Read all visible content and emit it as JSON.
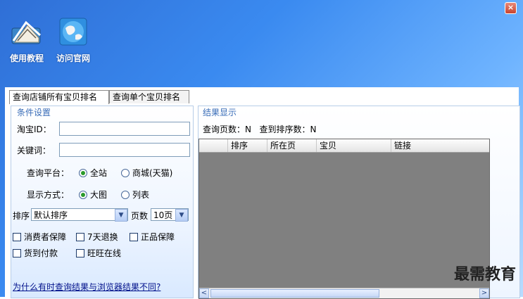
{
  "window": {
    "close_glyph": "×"
  },
  "toolbar": {
    "items": [
      {
        "label": "使用教程",
        "icon": "tutorial-icon"
      },
      {
        "label": "访问官网",
        "icon": "globe-icon"
      }
    ]
  },
  "tabs": [
    {
      "label": "查询店铺所有宝贝排名",
      "active": true
    },
    {
      "label": "查询单个宝贝排名",
      "active": false
    }
  ],
  "conditions": {
    "title": "条件设置",
    "taobao_id_label": "淘宝ID：",
    "taobao_id_value": "",
    "keyword_label": "关键词：",
    "keyword_value": "",
    "platform_label": "查询平台：",
    "platform_options": [
      {
        "label": "全站",
        "selected": true
      },
      {
        "label": "商城(天猫)",
        "selected": false
      }
    ],
    "display_label": "显示方式：",
    "display_options": [
      {
        "label": "大图",
        "selected": true
      },
      {
        "label": "列表",
        "selected": false
      }
    ],
    "sort_label": "排序",
    "sort_value": "默认排序",
    "pages_label": "页数",
    "pages_value": "10页",
    "checkboxes": [
      {
        "label": "消费者保障",
        "checked": false
      },
      {
        "label": "7天退换",
        "checked": false
      },
      {
        "label": "正品保障",
        "checked": false
      },
      {
        "label": "货到付款",
        "checked": false
      },
      {
        "label": "旺旺在线",
        "checked": false
      }
    ],
    "help_link": "为什么有时查询结果与浏览器结果不同?"
  },
  "results": {
    "title": "结果显示",
    "pages_queried": "查询页数：N",
    "ranks_found": "查到排序数：N",
    "columns": [
      "排序",
      "所在页",
      "宝贝",
      "链接"
    ],
    "scroll_left": "<",
    "scroll_right": ">"
  },
  "watermark": "最需教育",
  "colors": {
    "title_bar": "#2f6fd6",
    "group_title": "#3a6db8",
    "link": "#00108a",
    "grid_bg": "#808080"
  }
}
